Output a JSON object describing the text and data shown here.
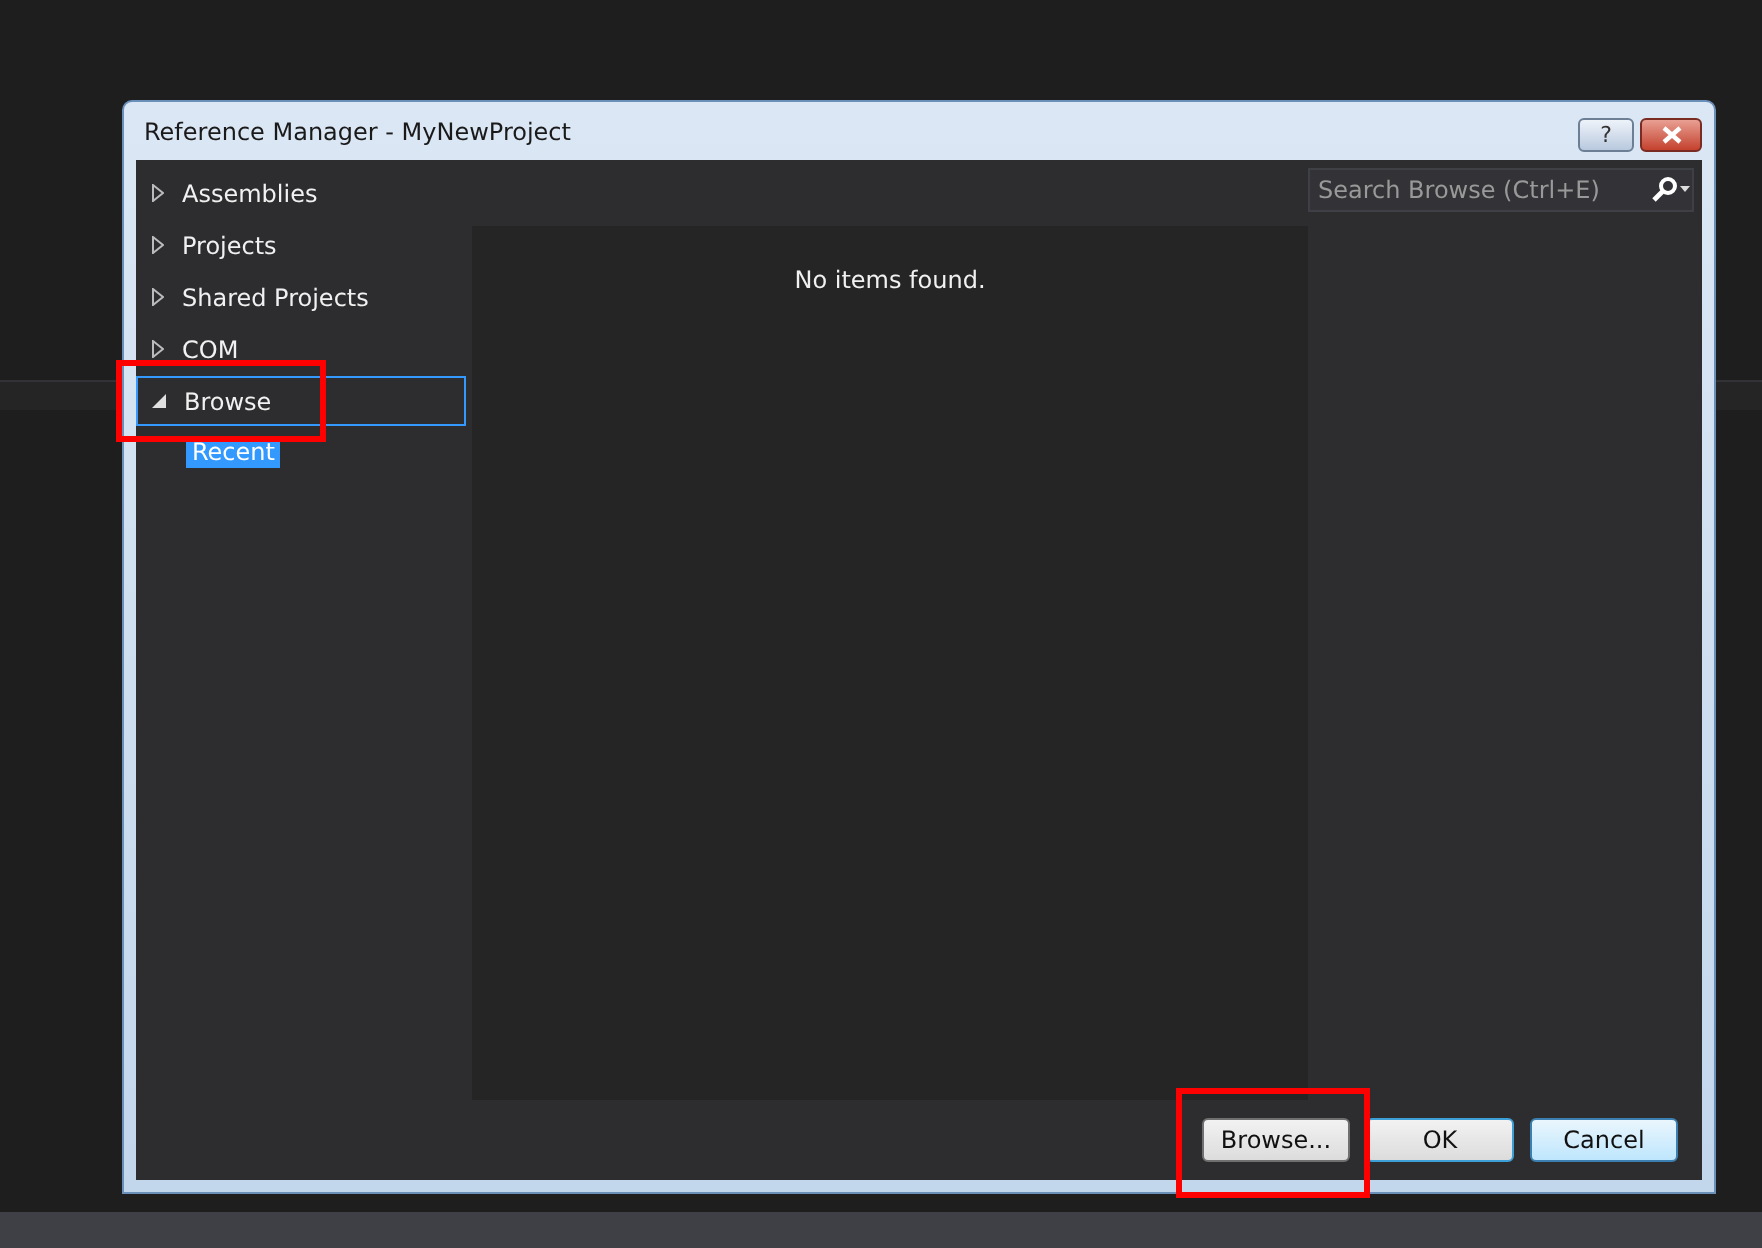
{
  "window": {
    "title": "Reference Manager - MyNewProject",
    "help": "?"
  },
  "tree": [
    {
      "label": "Assemblies",
      "expanded": false,
      "selected": false
    },
    {
      "label": "Projects",
      "expanded": false,
      "selected": false
    },
    {
      "label": "Shared Projects",
      "expanded": false,
      "selected": false
    },
    {
      "label": "COM",
      "expanded": false,
      "selected": false
    },
    {
      "label": "Browse",
      "expanded": true,
      "selected": true,
      "children": [
        {
          "label": "Recent",
          "selected": true
        }
      ]
    }
  ],
  "search": {
    "placeholder": "Search Browse (Ctrl+E)"
  },
  "content": {
    "message": "No items found."
  },
  "buttons": [
    {
      "label": "Browse...",
      "kind": "normal"
    },
    {
      "label": "OK",
      "kind": "focused"
    },
    {
      "label": "Cancel",
      "kind": "hot"
    }
  ]
}
